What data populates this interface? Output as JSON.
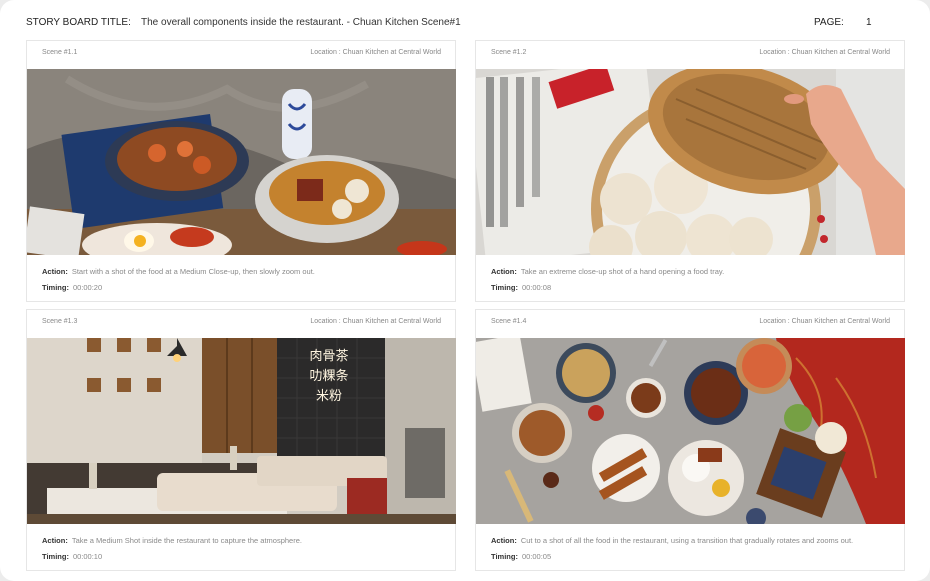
{
  "header": {
    "title_label": "STORY BOARD TITLE:",
    "title_value": "The overall components inside the restaurant. - Chuan Kitchen Scene#1",
    "page_label": "PAGE:",
    "page_value": "1"
  },
  "scenes": [
    {
      "scene": "Scene #1.1",
      "location": "Location : Chuan Kitchen at Central World",
      "action_label": "Action:",
      "action": "Start with a shot of the food at a Medium Close-up, then slowly zoom out.",
      "timing_label": "Timing:",
      "timing": "00:00:20"
    },
    {
      "scene": "Scene #1.2",
      "location": "Location : Chuan Kitchen at Central World",
      "action_label": "Action:",
      "action": "Take an extreme close-up shot of a hand opening a food tray.",
      "timing_label": "Timing:",
      "timing": "00:00:08"
    },
    {
      "scene": "Scene #1.3",
      "location": "Location : Chuan Kitchen at Central World",
      "action_label": "Action:",
      "action": "Take a Medium Shot inside the restaurant to capture the atmosphere.",
      "timing_label": "Timing:",
      "timing": "00:00:10",
      "neon_lines": [
        "肉骨茶",
        "叻粿条",
        "米粉"
      ]
    },
    {
      "scene": "Scene #1.4",
      "location": "Location : Chuan Kitchen at Central World",
      "action_label": "Action:",
      "action": "Cut to a shot of all the food in the restaurant, using a transition that gradually rotates and zooms out.",
      "timing_label": "Timing:",
      "timing": "00:00:05"
    }
  ]
}
